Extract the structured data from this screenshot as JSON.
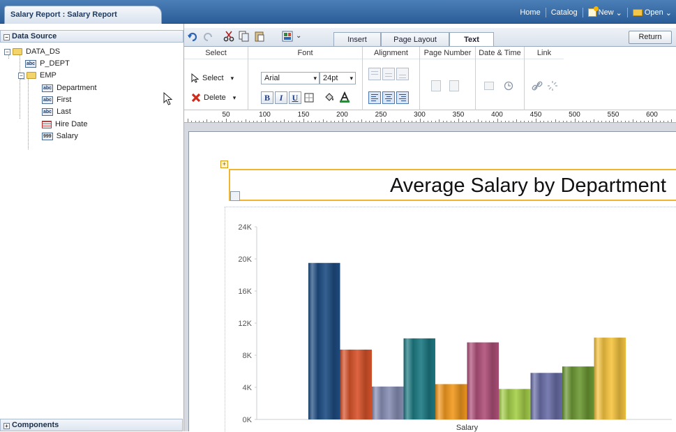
{
  "document_tab": {
    "title": "Salary Report : Salary Report"
  },
  "topnav": {
    "home": "Home",
    "catalog": "Catalog",
    "new": "New",
    "open": "Open"
  },
  "left_panel": {
    "data_source_header": "Data Source",
    "components_header": "Components",
    "tree": {
      "root": "DATA_DS",
      "p_dept": "P_DEPT",
      "emp": "EMP",
      "fields": [
        {
          "label": "Department",
          "type_icon": "abc"
        },
        {
          "label": "First",
          "type_icon": "abc"
        },
        {
          "label": "Last",
          "type_icon": "abc"
        },
        {
          "label": "Hire Date",
          "type_icon": "date"
        },
        {
          "label": "Salary",
          "type_icon": "999"
        }
      ],
      "p_dept_icon": "abc"
    }
  },
  "tabs": {
    "insert": "Insert",
    "page_layout": "Page Layout",
    "text": "Text",
    "active": "Text"
  },
  "return_button": "Return",
  "ribbon": {
    "select_group": "Select",
    "select_btn": "Select",
    "delete_btn": "Delete",
    "font_group": "Font",
    "font_name": "Arial",
    "font_size": "24pt",
    "bold": "B",
    "italic": "I",
    "underline": "U",
    "alignment_group": "Alignment",
    "page_number_group": "Page Number",
    "date_time_group": "Date & Time",
    "link_group": "Link"
  },
  "ruler": {
    "labels": [
      "50",
      "100",
      "150",
      "200",
      "250",
      "300",
      "350",
      "400",
      "450",
      "500",
      "550",
      "600"
    ]
  },
  "report_title": "Average Salary by Department",
  "chart_data": {
    "type": "bar",
    "xlabel": "Salary",
    "ylabel": "",
    "ylim": [
      0,
      24000
    ],
    "yticks": [
      "0K",
      "4K",
      "8K",
      "12K",
      "16K",
      "20K",
      "24K"
    ],
    "categories": [
      "Salary"
    ],
    "series": [
      {
        "values": [
          19500
        ],
        "color": "#1f4e84"
      },
      {
        "values": [
          8700
        ],
        "color": "#d9542c"
      },
      {
        "values": [
          4100
        ],
        "color": "#8890b5"
      },
      {
        "values": [
          10100
        ],
        "color": "#1d7b84"
      },
      {
        "values": [
          4400
        ],
        "color": "#f39a1f"
      },
      {
        "values": [
          9600
        ],
        "color": "#b0507a"
      },
      {
        "values": [
          3800
        ],
        "color": "#a6d04a"
      },
      {
        "values": [
          5800
        ],
        "color": "#6a6fa8"
      },
      {
        "values": [
          6600
        ],
        "color": "#6d9a35"
      },
      {
        "values": [
          10200
        ],
        "color": "#f6c540"
      }
    ],
    "grid": false
  },
  "colors": {
    "accent": "#2b5d98",
    "selection": "#f2b530"
  }
}
